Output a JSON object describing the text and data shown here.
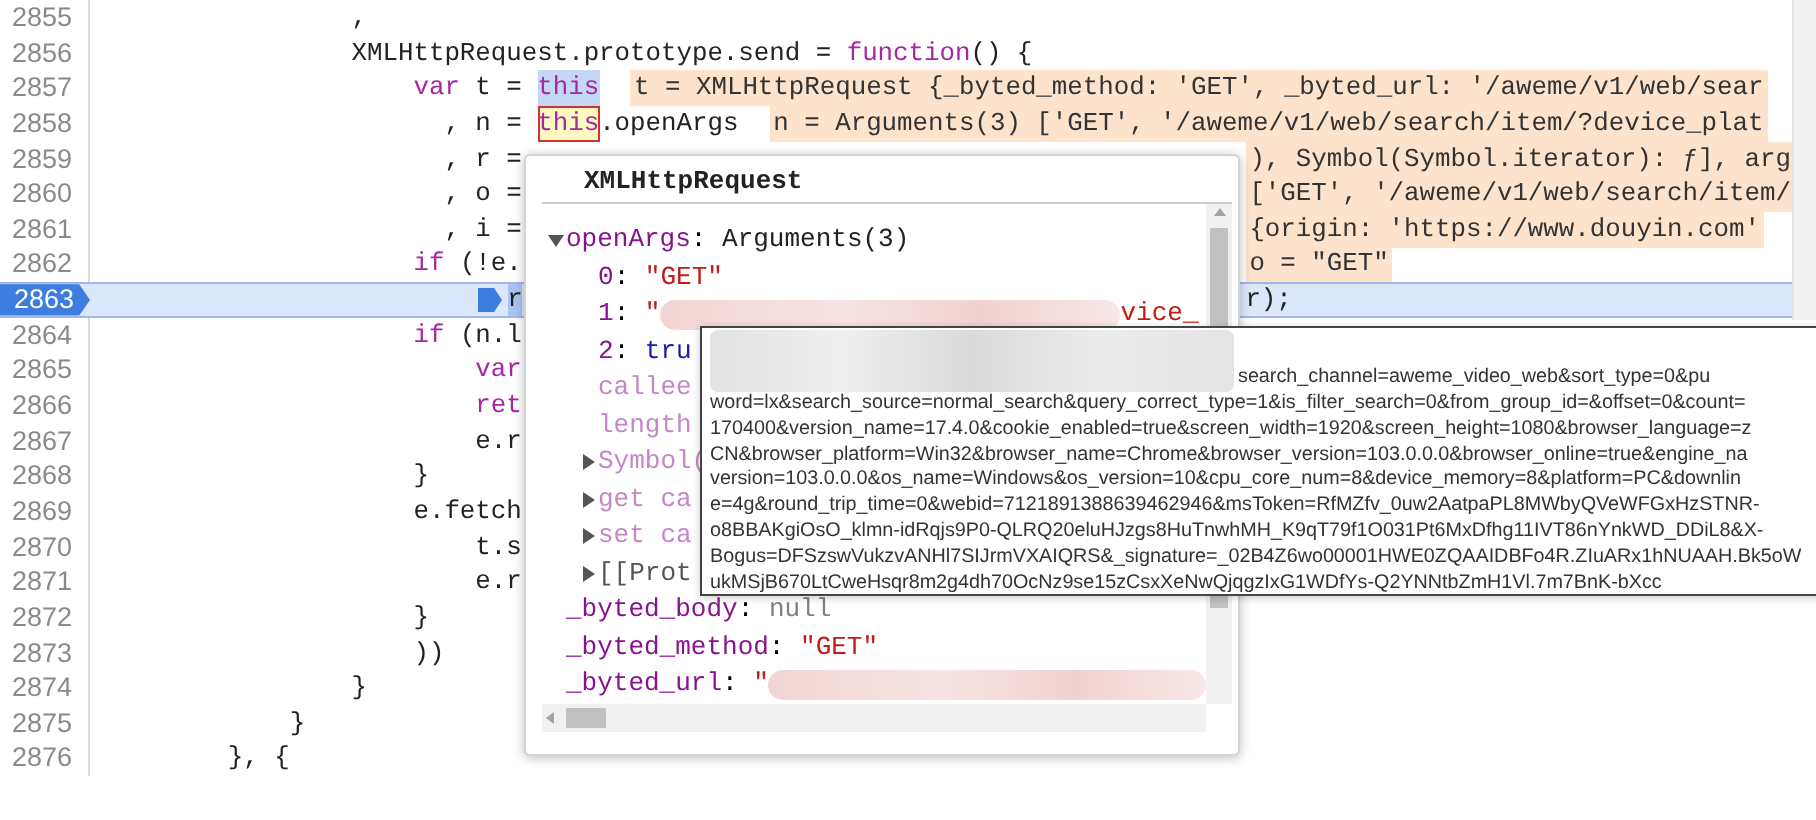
{
  "editor": {
    "lines": [
      {
        "number": "2855",
        "current": false,
        "code": [
          {
            "kind": "plain",
            "text": "                ,"
          }
        ]
      },
      {
        "number": "2856",
        "current": false,
        "code": [
          {
            "kind": "plain",
            "text": "                XMLHttpRequest.prototype.send = "
          },
          {
            "kind": "keyword",
            "text": "function"
          },
          {
            "kind": "plain",
            "text": "() {"
          }
        ]
      },
      {
        "number": "2857",
        "current": false,
        "code": [
          {
            "kind": "keyword",
            "text": "                    var"
          },
          {
            "kind": "plain",
            "text": " t = "
          },
          {
            "kind": "hover",
            "text": "this"
          },
          {
            "kind": "inline",
            "text": "t = XMLHttpRequest {_byted_method: 'GET', _byted_url: '/aweme/v1/web/sear"
          }
        ]
      },
      {
        "number": "2858",
        "current": false,
        "code": [
          {
            "kind": "plain",
            "text": "                      , n = "
          },
          {
            "kind": "inspected",
            "text": "this"
          },
          {
            "kind": "plain",
            "text": ".openArgs"
          },
          {
            "kind": "inline",
            "text": "n = Arguments(3) ['GET', '/aweme/v1/web/search/item/?device_plat"
          }
        ]
      },
      {
        "number": "2859",
        "current": false,
        "code": [
          {
            "kind": "plain",
            "text": "                      , r ="
          }
        ],
        "tail": [
          {
            "kind": "inline",
            "text": "), Symbol(Symbol.iterator): ƒ], arg"
          }
        ]
      },
      {
        "number": "2860",
        "current": false,
        "code": [
          {
            "kind": "plain",
            "text": "                      , o ="
          }
        ],
        "tail": [
          {
            "kind": "inline",
            "text": "['GET', '/aweme/v1/web/search/item/"
          }
        ]
      },
      {
        "number": "2861",
        "current": false,
        "code": [
          {
            "kind": "plain",
            "text": "                      , i ="
          }
        ],
        "tail": [
          {
            "kind": "inline",
            "text": "{origin: 'https://www.douyin.com'"
          }
        ]
      },
      {
        "number": "2862",
        "current": false,
        "code": [
          {
            "kind": "keyword",
            "text": "                    if"
          },
          {
            "kind": "plain",
            "text": " (!e."
          }
        ],
        "tail": [
          {
            "kind": "inline",
            "text": "o = \"GET\""
          }
        ]
      },
      {
        "number": "2863",
        "current": true,
        "code": [
          {
            "kind": "paused",
            "text": "                        r"
          }
        ],
        "tail": [
          {
            "kind": "plain",
            "text": "r);"
          }
        ]
      },
      {
        "number": "2864",
        "current": false,
        "code": [
          {
            "kind": "keyword",
            "text": "                    if"
          },
          {
            "kind": "plain",
            "text": " (n.l"
          }
        ]
      },
      {
        "number": "2865",
        "current": false,
        "code": [
          {
            "kind": "keyword",
            "text": "                        var"
          }
        ]
      },
      {
        "number": "2866",
        "current": false,
        "code": [
          {
            "kind": "keyword",
            "text": "                        ret"
          }
        ]
      },
      {
        "number": "2867",
        "current": false,
        "code": [
          {
            "kind": "plain",
            "text": "                        e.r"
          }
        ]
      },
      {
        "number": "2868",
        "current": false,
        "code": [
          {
            "kind": "plain",
            "text": "                    }"
          }
        ]
      },
      {
        "number": "2869",
        "current": false,
        "code": [
          {
            "kind": "plain",
            "text": "                    e.fetch"
          }
        ]
      },
      {
        "number": "2870",
        "current": false,
        "code": [
          {
            "kind": "plain",
            "text": "                        t.s"
          }
        ]
      },
      {
        "number": "2871",
        "current": false,
        "code": [
          {
            "kind": "plain",
            "text": "                        e.r"
          }
        ]
      },
      {
        "number": "2872",
        "current": false,
        "code": [
          {
            "kind": "plain",
            "text": "                    }"
          }
        ]
      },
      {
        "number": "2873",
        "current": false,
        "code": [
          {
            "kind": "plain",
            "text": "                    ))"
          }
        ]
      },
      {
        "number": "2874",
        "current": false,
        "code": [
          {
            "kind": "plain",
            "text": "                }"
          }
        ]
      },
      {
        "number": "2875",
        "current": false,
        "code": [
          {
            "kind": "plain",
            "text": "            }"
          }
        ]
      },
      {
        "number": "2876",
        "current": false,
        "code": [
          {
            "kind": "plain",
            "text": "        }, {"
          }
        ]
      }
    ]
  },
  "popover": {
    "title": "XMLHttpRequest",
    "properties": [
      {
        "name": "openArgs",
        "separator": ":",
        "value": "Arguments(3)",
        "kind": "object",
        "enumerable": true,
        "expandable": true,
        "expanded": true,
        "children": [
          {
            "name": "0",
            "separator": ":",
            "value": "\"GET\"",
            "kind": "string",
            "enumerable": true
          },
          {
            "name": "1",
            "separator": ":",
            "value": "\"",
            "redacted": true,
            "value_tail": "vice_",
            "kind": "string",
            "enumerable": true
          },
          {
            "name": "2",
            "separator": ":",
            "value": "tru",
            "kind": "boolean",
            "enumerable": true
          },
          {
            "name": "callee",
            "kind": "property",
            "enumerable": false
          },
          {
            "name": "length",
            "kind": "property",
            "enumerable": false
          },
          {
            "name": "Symbol(",
            "kind": "property",
            "enumerable": false,
            "expandable": true,
            "expanded": false
          },
          {
            "name": "get ca",
            "kind": "property",
            "enumerable": false,
            "expandable": true,
            "expanded": false
          },
          {
            "name": "set ca",
            "kind": "property",
            "enumerable": false,
            "expandable": true,
            "expanded": false
          },
          {
            "name": "[[Prot",
            "kind": "internal",
            "expandable": true,
            "expanded": false
          }
        ]
      },
      {
        "name": "_byted_body",
        "separator": ":",
        "value": "null",
        "kind": "null",
        "enumerable": true
      },
      {
        "name": "_byted_method",
        "separator": ":",
        "value": "\"GET\"",
        "kind": "string",
        "enumerable": true
      },
      {
        "name": "_byted_url",
        "separator": ":",
        "value": "\"",
        "redacted": true,
        "kind": "string",
        "enumerable": true
      }
    ]
  },
  "url_tooltip": {
    "lines": [
      {
        "text": "search_channel=aweme_video_web&sort_type=0&pu",
        "redacted": true
      },
      {
        "text": "word=lx&search_source=normal_search&query_correct_type=1&is_filter_search=0&from_group_id=&offset=0&count=",
        "redacted": false
      },
      {
        "text": "170400&version_name=17.4.0&cookie_enabled=true&screen_width=1920&screen_height=1080&browser_language=z",
        "redacted": false
      },
      {
        "text": "CN&browser_platform=Win32&browser_name=Chrome&browser_version=103.0.0.0&browser_online=true&engine_na",
        "redacted": false
      },
      {
        "text": "version=103.0.0.0&os_name=Windows&os_version=10&cpu_core_num=8&device_memory=8&platform=PC&downlin",
        "redacted": false
      },
      {
        "text": "e=4g&round_trip_time=0&webid=7121891388639462946&msToken=RfMZfv_0uw2AatpaPL8MWbyQVeWFGxHzSTNR-",
        "redacted": false
      },
      {
        "text": "o8BBAKgiOsO_klmn-idRqjs9P0-QLRQ20eluHJzgs8HuTnwhMH_K9qT79f1O031Pt6MxDfhg11IVT86nYnkWD_DDiL8&X-",
        "redacted": false
      },
      {
        "text": "Bogus=DFSzswVukzvANHl7SIJrmVXAIQRS&_signature=_02B4Z6wo00001HWE0ZQAAIDBFo4R.ZIuARx1hNUAAH.Bk5oW",
        "redacted": false
      },
      {
        "text": "ukMSjB670LtCweHsqr8m2g4dh70OcNz9se15zCsxXeNwQjqgzIxG1WDfYs-Q2YNNtbZmH1Vl.7m7BnK-bXcc",
        "redacted": false
      }
    ]
  }
}
